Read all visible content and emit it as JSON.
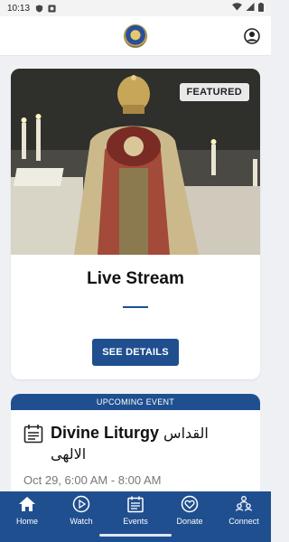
{
  "status_bar": {
    "time": "10:13"
  },
  "header": {
    "logo_icon": "church-logo-icon",
    "profile_icon": "account-circle-icon"
  },
  "featured": {
    "badge": "FEATURED",
    "title": "Live Stream",
    "button_label": "SEE DETAILS"
  },
  "upcoming_event": {
    "header_label": "UPCOMING EVENT",
    "title": "Divine Liturgy",
    "title_ar": "القداس الالهى",
    "time": "Oct 29, 6:00 AM - 8:00 AM"
  },
  "bottom_nav": {
    "items": [
      {
        "label": "Home",
        "icon": "home-icon"
      },
      {
        "label": "Watch",
        "icon": "play-circle-icon"
      },
      {
        "label": "Events",
        "icon": "calendar-icon"
      },
      {
        "label": "Donate",
        "icon": "heart-icon"
      },
      {
        "label": "Connect",
        "icon": "people-icon"
      }
    ]
  },
  "colors": {
    "primary": "#1f4f8f",
    "background": "#eef0f4"
  }
}
